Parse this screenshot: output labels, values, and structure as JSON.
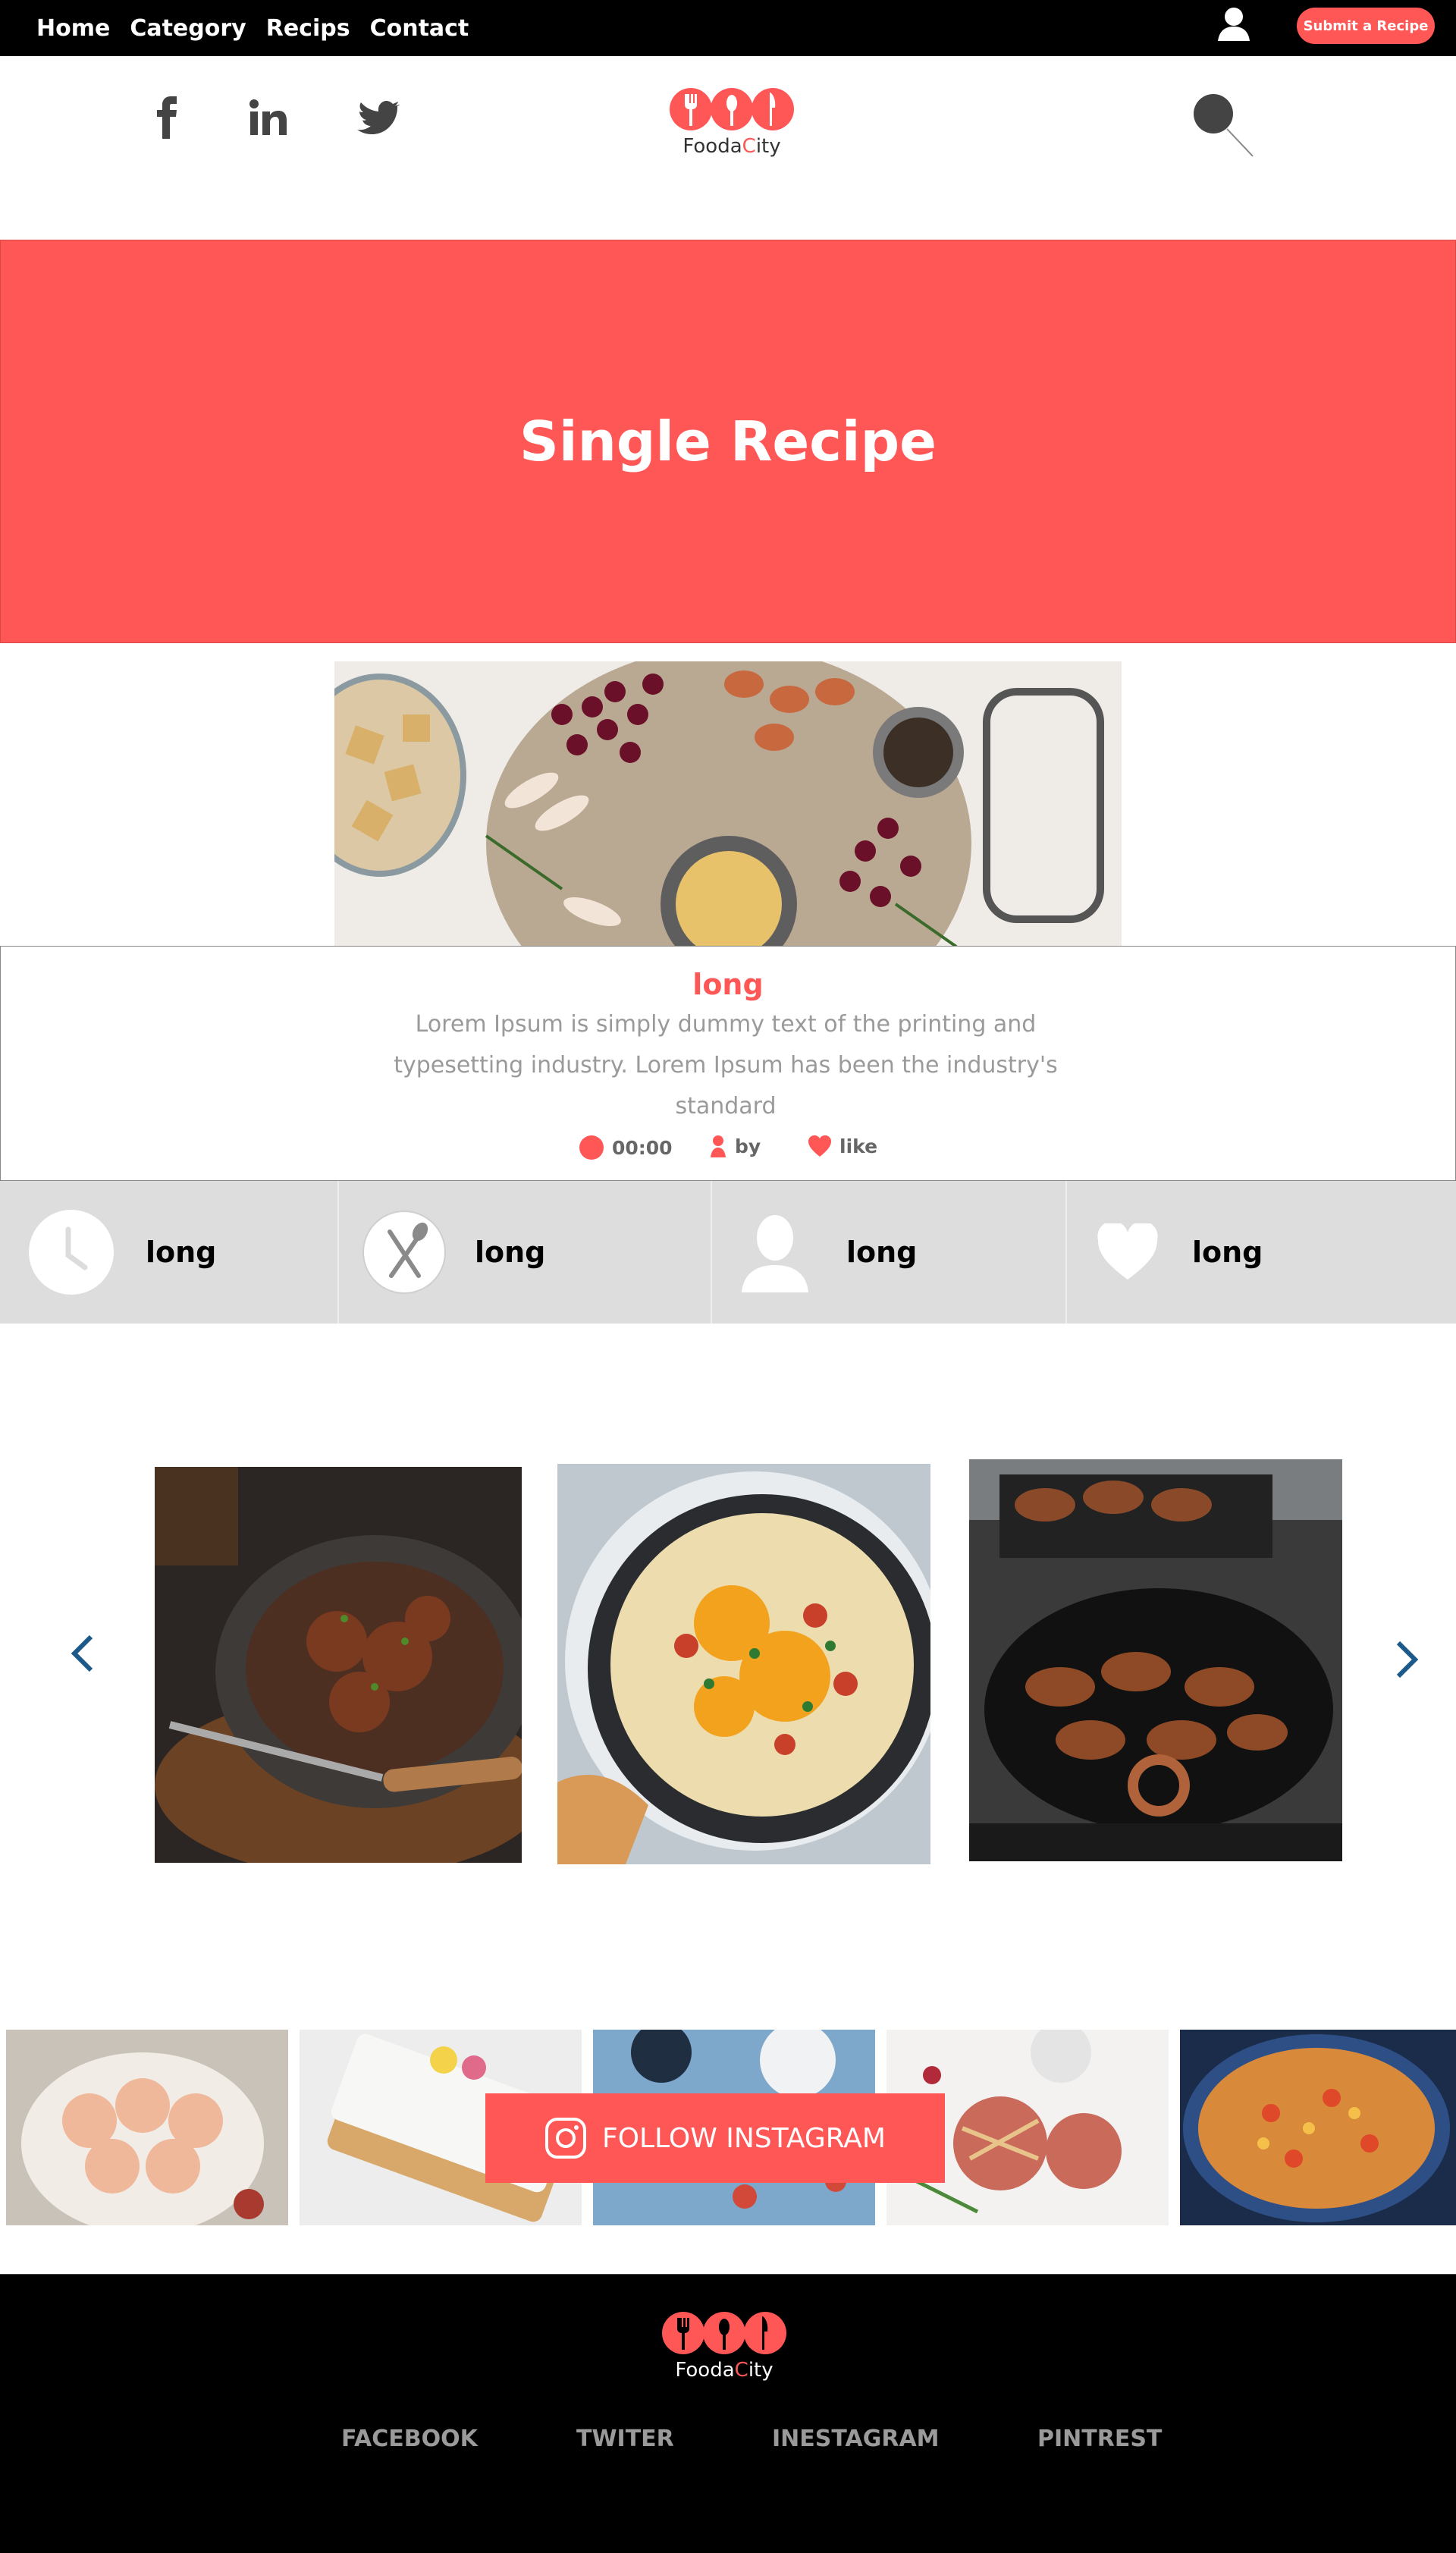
{
  "nav": {
    "links": [
      "Home",
      "Category",
      "Recips",
      "Contact"
    ],
    "submit_label": "Submit a Recipe"
  },
  "header": {
    "social_icons": [
      "facebook-icon",
      "linkedin-icon",
      "twitter-icon"
    ],
    "logo": {
      "brand_start": "Fooda",
      "brand_accent": "C",
      "brand_end": "ity"
    }
  },
  "hero": {
    "title": "Single Recipe"
  },
  "recipe": {
    "title": "long",
    "description": "Lorem Ipsum is simply dummy text of the printing and typesetting industry. Lorem Ipsum has been the industry's standard",
    "meta": {
      "time": "00:00",
      "author": "by",
      "likes": "like"
    }
  },
  "stats": [
    {
      "icon": "clock-icon",
      "label": "long"
    },
    {
      "icon": "fork-spoon-icon",
      "label": "long"
    },
    {
      "icon": "user-icon",
      "label": "long"
    },
    {
      "icon": "heart-icon",
      "label": "long"
    }
  ],
  "carousel": {
    "prev_icon": "chevron-left-icon",
    "next_icon": "chevron-right-icon"
  },
  "instagram": {
    "follow_label": "FOLLOW INSTAGRAM"
  },
  "footer": {
    "links": [
      "FACEBOOK",
      "TWITER",
      "INESTAGRAM",
      "PINTREST"
    ]
  },
  "colors": {
    "accent": "#ff5656",
    "nav_bg": "#000000",
    "strip_bg": "#ddddde"
  }
}
